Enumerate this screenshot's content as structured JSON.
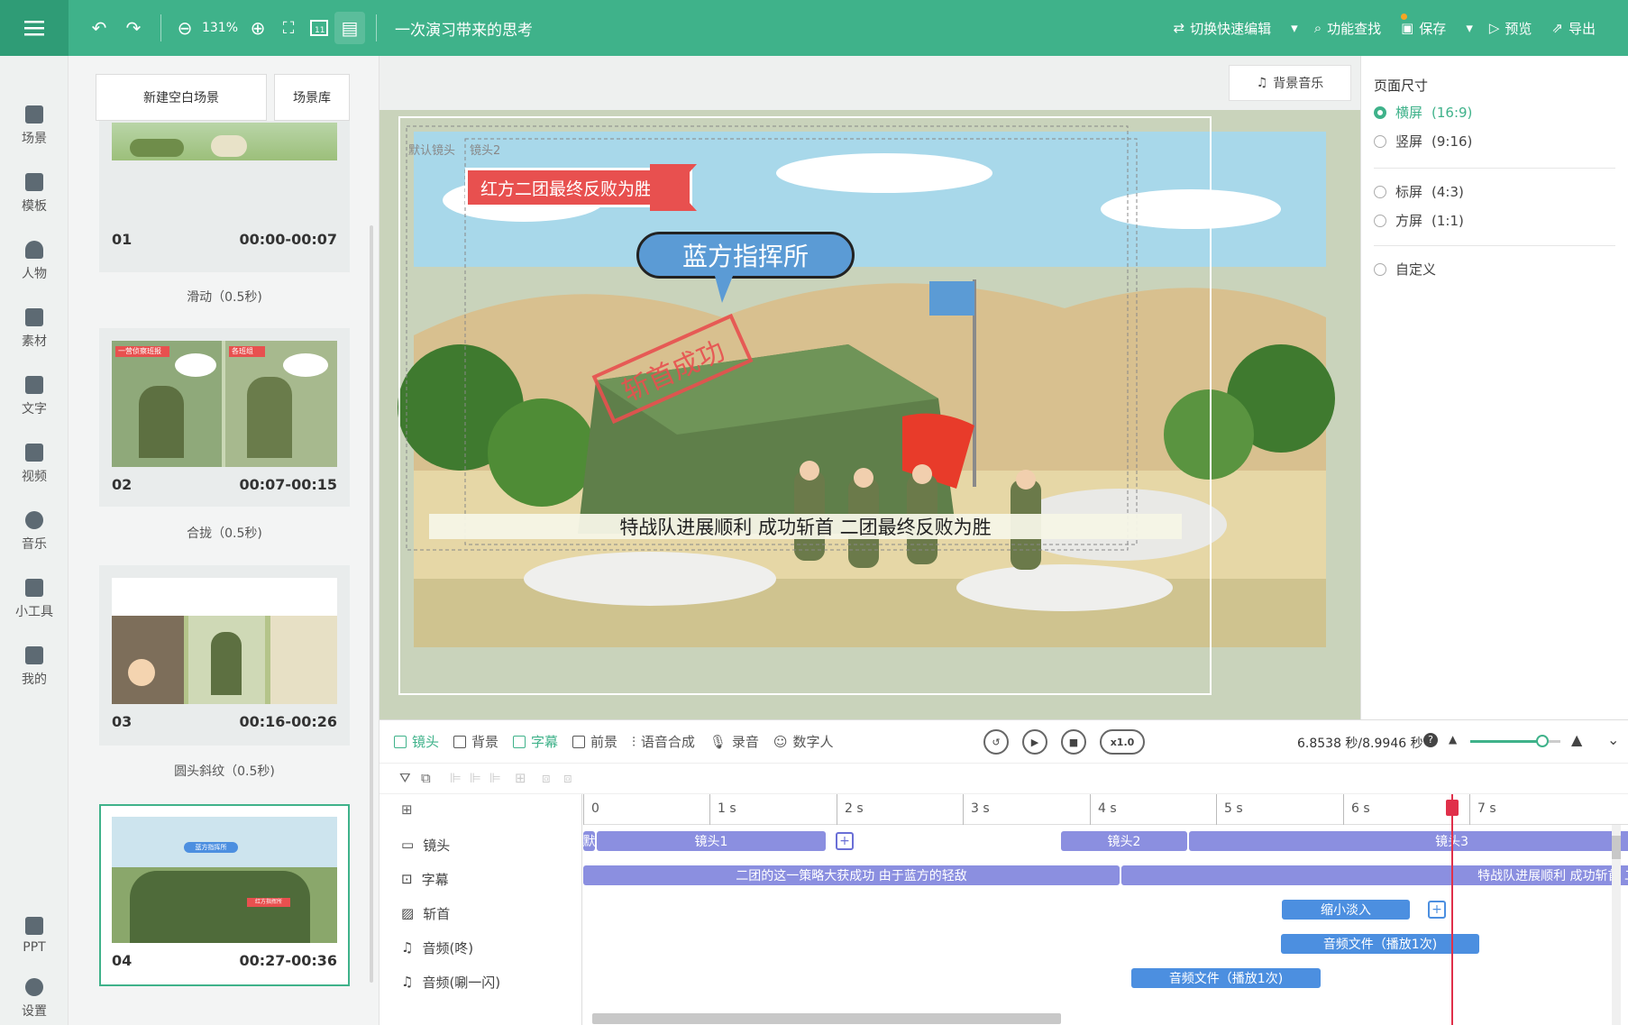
{
  "topbar": {
    "zoom": "131%",
    "doc_title": "一次演习带来的思考",
    "quick_edit": "切换快速编辑",
    "find": "功能查找",
    "save": "保存",
    "preview": "预览",
    "export": "导出"
  },
  "nav": [
    "场景",
    "模板",
    "人物",
    "素材",
    "文字",
    "视频",
    "音乐",
    "小工具",
    "我的"
  ],
  "nav_bottom": [
    "PPT",
    "设置"
  ],
  "scene_panel": {
    "new_blank": "新建空白场景",
    "library": "场景库",
    "scenes": [
      {
        "num": "01",
        "time": "00:00-00:07"
      },
      {
        "num": "02",
        "time": "00:07-00:15"
      },
      {
        "num": "03",
        "time": "00:16-00:26"
      },
      {
        "num": "04",
        "time": "00:27-00:36"
      }
    ],
    "transitions": [
      "滑动（0.5秒)",
      "合拢（0.5秒)",
      "圆头斜纹（0.5秒)"
    ],
    "thumb_labels": [
      "一营侦察班报",
      "蓝方指挥所",
      "红方指挥",
      "各班组",
      "蓝方指挥所",
      "红方指挥所"
    ]
  },
  "canvas": {
    "bgm": "背景音乐",
    "cam_default": "默认镜头",
    "cam2": "镜头2",
    "banner": "红方二团最终反败为胜",
    "bubble": "蓝方指挥所",
    "stamp": "斩首成功",
    "subtitle": "特战队进展顺利  成功斩首  二团最终反败为胜"
  },
  "right_panel": {
    "title": "页面尺寸",
    "options": [
      {
        "label": "横屏",
        "ratio": "(16:9)",
        "selected": true
      },
      {
        "label": "竖屏",
        "ratio": "(9:16)",
        "selected": false
      },
      {
        "label": "标屏",
        "ratio": "(4:3)",
        "selected": false
      },
      {
        "label": "方屏",
        "ratio": "(1:1)",
        "selected": false
      },
      {
        "label": "自定义",
        "ratio": "",
        "selected": false
      }
    ]
  },
  "timeline": {
    "tabs": [
      "镜头",
      "背景",
      "字幕",
      "前景",
      "语音合成",
      "录音",
      "数字人"
    ],
    "speed": "x1.0",
    "time_readout": "6.8538 秒/8.9946 秒",
    "zoom_level": 0.8,
    "ticks": [
      "0",
      "1 s",
      "2 s",
      "3 s",
      "4 s",
      "5 s",
      "6 s",
      "7 s"
    ],
    "tracks": [
      "镜头",
      "字幕",
      "斩首",
      "音频(咚)",
      "音频(唰一闪)"
    ],
    "clips": {
      "cam_default": "默",
      "cam1": "镜头1",
      "cam2": "镜头2",
      "cam3": "镜头3",
      "sub1": "二团的这一策略大获成功  由于蓝方的轻敌",
      "sub2": "特战队进展顺利  成功斩首  二团最",
      "fx": "缩小淡入",
      "audio1": "音频文件（播放1次)",
      "audio2": "音频文件（播放1次)"
    },
    "playhead_time_s": 6.8538
  },
  "colors": {
    "brand": "#3fb28a",
    "clip": "#8b8fe0",
    "clip_blue": "#4c8fe0",
    "playhead": "#e0304a",
    "banner": "#e8504f",
    "bubble": "#4c8fe0"
  }
}
